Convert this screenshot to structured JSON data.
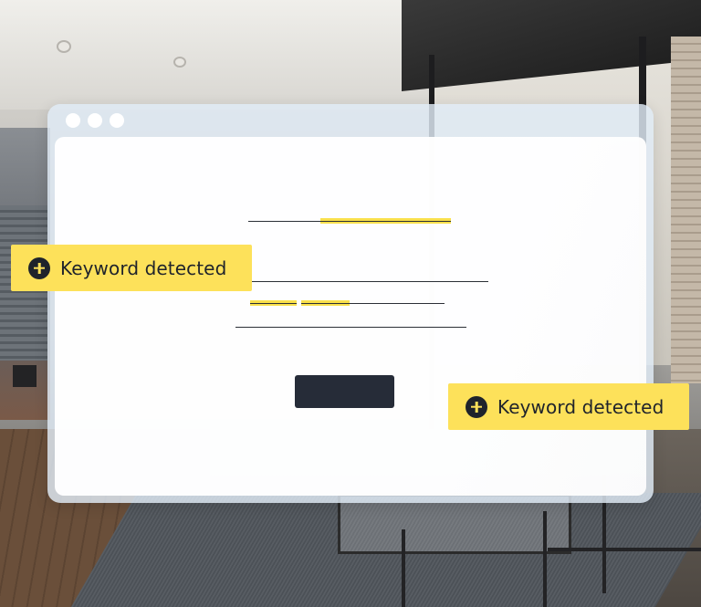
{
  "tags": [
    {
      "label": "Keyword detected",
      "icon": "plus-circle-icon"
    },
    {
      "label": "Keyword detected",
      "icon": "plus-circle-icon"
    }
  ],
  "colors": {
    "highlight": "#f9e04b",
    "tag_background": "#fde15a",
    "button": "#262c38",
    "window_frame": "#e1ecf6"
  }
}
